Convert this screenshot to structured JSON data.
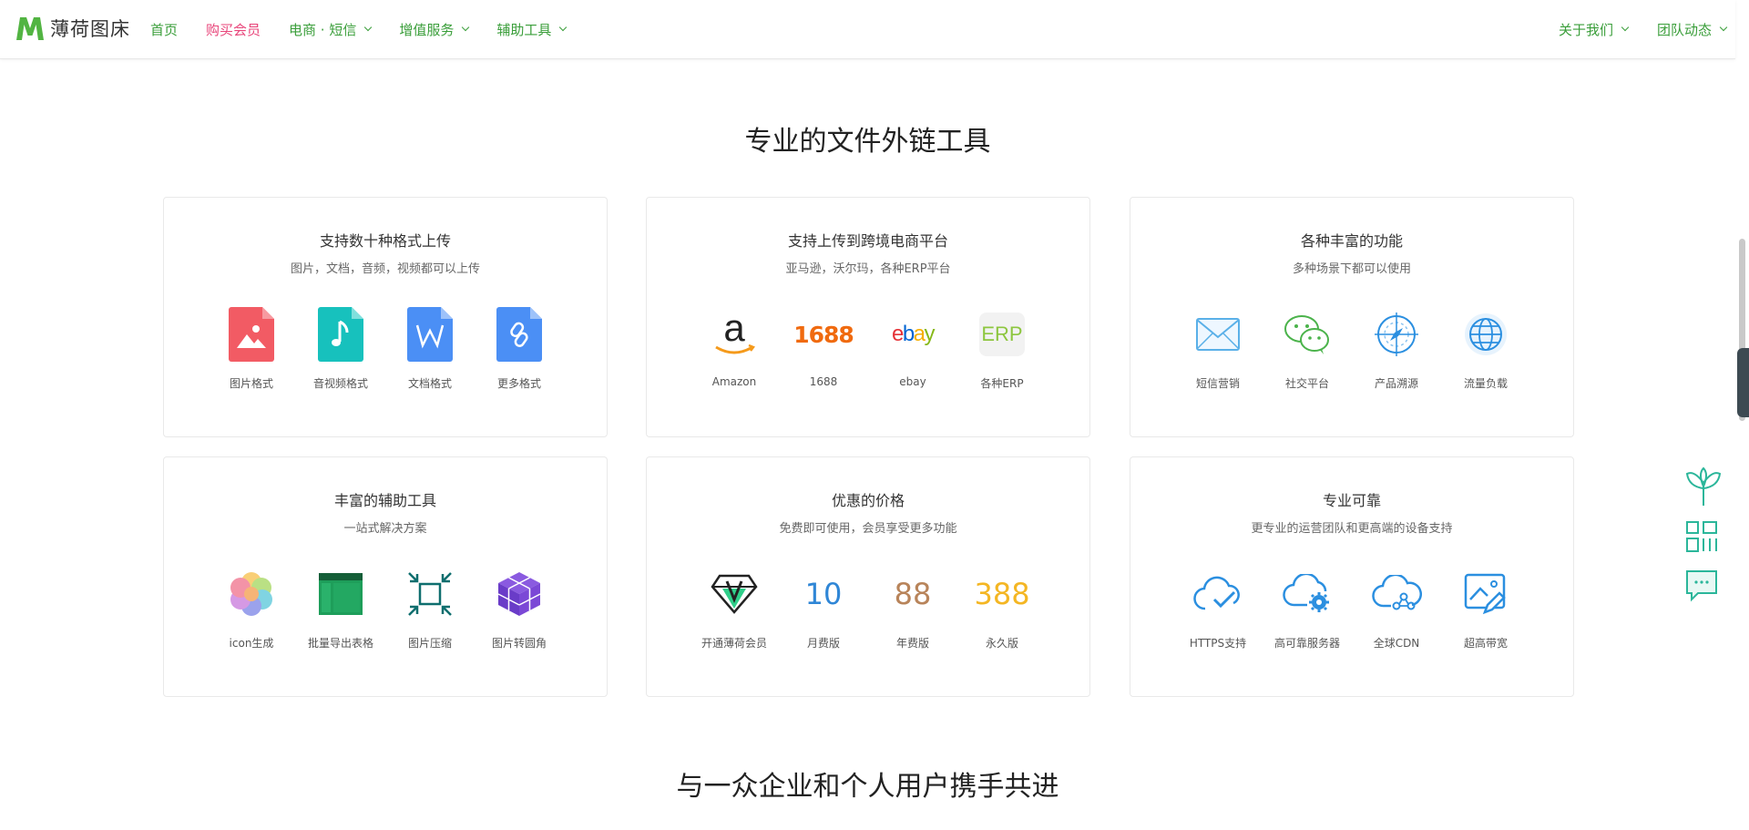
{
  "header": {
    "logo_text": "薄荷图床",
    "nav": [
      {
        "label": "首页",
        "dropdown": false
      },
      {
        "label": "购买会员",
        "dropdown": false
      },
      {
        "label": "电商 · 短信",
        "dropdown": true
      },
      {
        "label": "增值服务",
        "dropdown": true
      },
      {
        "label": "辅助工具",
        "dropdown": true
      }
    ],
    "nav_right": [
      {
        "label": "关于我们",
        "dropdown": true
      },
      {
        "label": "团队动态",
        "dropdown": true
      }
    ]
  },
  "section1": {
    "title": "专业的文件外链工具"
  },
  "section2": {
    "title": "与一众企业和个人用户携手共进"
  },
  "cards": [
    {
      "title": "支持数十种格式上传",
      "subtitle": "图片，文档，音频，视频都可以上传",
      "items": [
        {
          "label": "图片格式",
          "icon": "image-file-icon"
        },
        {
          "label": "音视频格式",
          "icon": "audio-file-icon"
        },
        {
          "label": "文档格式",
          "icon": "word-file-icon"
        },
        {
          "label": "更多格式",
          "icon": "link-file-icon"
        }
      ]
    },
    {
      "title": "支持上传到跨境电商平台",
      "subtitle": "亚马逊，沃尔玛，各种ERP平台",
      "items": [
        {
          "label": "Amazon",
          "icon": "amazon-logo-icon",
          "glyph": "a"
        },
        {
          "label": "1688",
          "icon": "1688-logo-icon",
          "glyph": "1688"
        },
        {
          "label": "ebay",
          "icon": "ebay-logo-icon",
          "glyph": [
            "e",
            "b",
            "a",
            "y"
          ]
        },
        {
          "label": "各种ERP",
          "icon": "erp-icon",
          "glyph": "ERP"
        }
      ]
    },
    {
      "title": "各种丰富的功能",
      "subtitle": "多种场景下都可以使用",
      "items": [
        {
          "label": "短信营销",
          "icon": "envelope-icon"
        },
        {
          "label": "社交平台",
          "icon": "wechat-icon"
        },
        {
          "label": "产品溯源",
          "icon": "compass-icon"
        },
        {
          "label": "流量负载",
          "icon": "globe-icon"
        }
      ]
    },
    {
      "title": "丰富的辅助工具",
      "subtitle": "一站式解决方案",
      "items": [
        {
          "label": "icon生成",
          "icon": "photos-flower-icon"
        },
        {
          "label": "批量导出表格",
          "icon": "table-icon"
        },
        {
          "label": "图片压缩",
          "icon": "compress-icon"
        },
        {
          "label": "图片转圆角",
          "icon": "cube-icon"
        }
      ]
    },
    {
      "title": "优惠的价格",
      "subtitle": "免费即可使用，会员享受更多功能",
      "items": [
        {
          "label": "开通薄荷会员",
          "icon": "vip-diamond-icon"
        },
        {
          "label": "月费版",
          "value": "10",
          "color": "#2f86d6"
        },
        {
          "label": "年费版",
          "value": "88",
          "color": "#b8845a"
        },
        {
          "label": "永久版",
          "value": "388",
          "color": "#f4b623"
        }
      ]
    },
    {
      "title": "专业可靠",
      "subtitle": "更专业的运营团队和更高端的设备支持",
      "items": [
        {
          "label": "HTTPS支持",
          "icon": "cloud-check-icon"
        },
        {
          "label": "高可靠服务器",
          "icon": "cloud-gear-icon"
        },
        {
          "label": "全球CDN",
          "icon": "cloud-network-icon"
        },
        {
          "label": "超高带宽",
          "icon": "image-edit-icon"
        }
      ]
    }
  ],
  "colors": {
    "brand_green": "#3a9e3a",
    "accent_pink": "#e8457a",
    "blue_icon": "#2b8fe0",
    "teal_float": "#2bb69a"
  }
}
